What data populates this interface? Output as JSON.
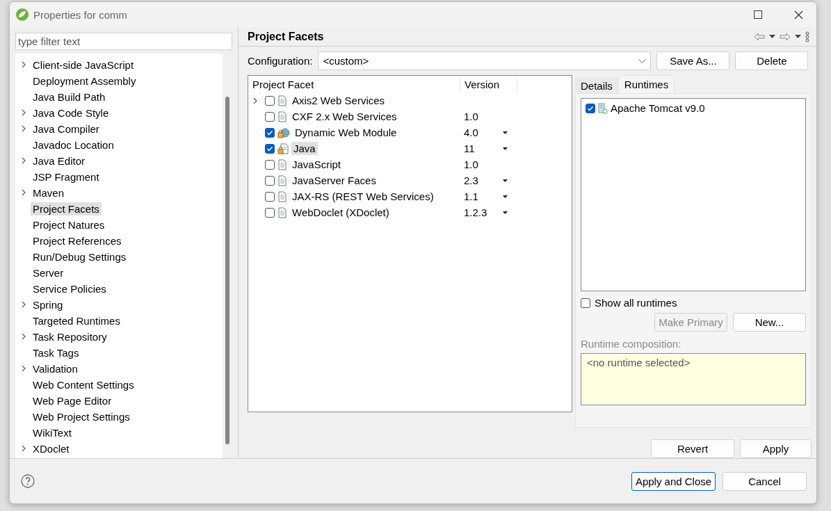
{
  "window": {
    "title": "Properties for comm"
  },
  "filter": {
    "placeholder": "type filter text"
  },
  "tree": [
    {
      "label": "Client-side JavaScript",
      "expandable": true,
      "selected": false
    },
    {
      "label": "Deployment Assembly",
      "expandable": false,
      "selected": false
    },
    {
      "label": "Java Build Path",
      "expandable": false,
      "selected": false
    },
    {
      "label": "Java Code Style",
      "expandable": true,
      "selected": false
    },
    {
      "label": "Java Compiler",
      "expandable": true,
      "selected": false
    },
    {
      "label": "Javadoc Location",
      "expandable": false,
      "selected": false
    },
    {
      "label": "Java Editor",
      "expandable": true,
      "selected": false
    },
    {
      "label": "JSP Fragment",
      "expandable": false,
      "selected": false
    },
    {
      "label": "Maven",
      "expandable": true,
      "selected": false
    },
    {
      "label": "Project Facets",
      "expandable": false,
      "selected": true
    },
    {
      "label": "Project Natures",
      "expandable": false,
      "selected": false
    },
    {
      "label": "Project References",
      "expandable": false,
      "selected": false
    },
    {
      "label": "Run/Debug Settings",
      "expandable": false,
      "selected": false
    },
    {
      "label": "Server",
      "expandable": false,
      "selected": false
    },
    {
      "label": "Service Policies",
      "expandable": false,
      "selected": false
    },
    {
      "label": "Spring",
      "expandable": true,
      "selected": false
    },
    {
      "label": "Targeted Runtimes",
      "expandable": false,
      "selected": false
    },
    {
      "label": "Task Repository",
      "expandable": true,
      "selected": false
    },
    {
      "label": "Task Tags",
      "expandable": false,
      "selected": false
    },
    {
      "label": "Validation",
      "expandable": true,
      "selected": false
    },
    {
      "label": "Web Content Settings",
      "expandable": false,
      "selected": false
    },
    {
      "label": "Web Page Editor",
      "expandable": false,
      "selected": false
    },
    {
      "label": "Web Project Settings",
      "expandable": false,
      "selected": false
    },
    {
      "label": "WikiText",
      "expandable": false,
      "selected": false
    },
    {
      "label": "XDoclet",
      "expandable": true,
      "selected": false
    }
  ],
  "page": {
    "title": "Project Facets",
    "configuration_label": "Configuration:",
    "configuration_value": "<custom>",
    "buttons": [
      "Save As...",
      "Delete"
    ]
  },
  "facets": {
    "columns": [
      "Project Facet",
      "Version"
    ],
    "rows": [
      {
        "name": "Axis2 Web Services",
        "version": "",
        "checked": false,
        "expandable": true,
        "selected": false,
        "has_versions": false,
        "kind": "doc"
      },
      {
        "name": "CXF 2.x Web Services",
        "version": "1.0",
        "checked": false,
        "expandable": false,
        "selected": false,
        "has_versions": false,
        "kind": "doc"
      },
      {
        "name": "Dynamic Web Module",
        "version": "4.0",
        "checked": true,
        "expandable": false,
        "selected": false,
        "has_versions": true,
        "kind": "locked-web"
      },
      {
        "name": "Java",
        "version": "11",
        "checked": true,
        "expandable": false,
        "selected": true,
        "has_versions": true,
        "kind": "locked-doc"
      },
      {
        "name": "JavaScript",
        "version": "1.0",
        "checked": false,
        "expandable": false,
        "selected": false,
        "has_versions": false,
        "kind": "doc"
      },
      {
        "name": "JavaServer Faces",
        "version": "2.3",
        "checked": false,
        "expandable": false,
        "selected": false,
        "has_versions": true,
        "kind": "doc"
      },
      {
        "name": "JAX-RS (REST Web Services)",
        "version": "1.1",
        "checked": false,
        "expandable": false,
        "selected": false,
        "has_versions": true,
        "kind": "doc"
      },
      {
        "name": "WebDoclet (XDoclet)",
        "version": "1.2.3",
        "checked": false,
        "expandable": false,
        "selected": false,
        "has_versions": true,
        "kind": "doc"
      }
    ]
  },
  "tabs": [
    {
      "label": "Details",
      "selected": false
    },
    {
      "label": "Runtimes",
      "selected": true
    }
  ],
  "runtimes": [
    {
      "name": "Apache Tomcat v9.0",
      "checked": true
    }
  ],
  "show_all_runtimes": {
    "label": "Show all runtimes",
    "checked": false
  },
  "runtime_buttons": [
    {
      "label": "Make Primary",
      "disabled": true
    },
    {
      "label": "New...",
      "disabled": false
    }
  ],
  "composition": {
    "label": "Runtime composition:",
    "text": "<no runtime selected>"
  },
  "page_buttons": [
    "Revert",
    "Apply"
  ],
  "dialog_buttons": [
    {
      "label": "Apply and Close",
      "default": true
    },
    {
      "label": "Cancel",
      "default": false
    }
  ]
}
